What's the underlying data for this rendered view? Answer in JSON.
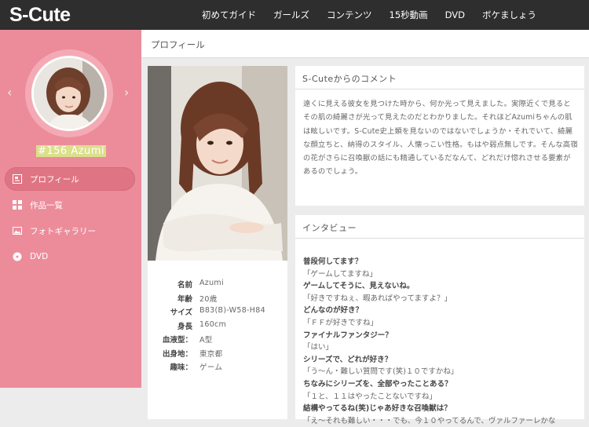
{
  "header": {
    "logo": "S-Cute",
    "nav": [
      "初めてガイド",
      "ガールズ",
      "コンテンツ",
      "15秒動画",
      "DVD",
      "ボケましょう"
    ]
  },
  "sidebar": {
    "member_name": "#156 Azumi",
    "prev_arrow": "‹",
    "next_arrow": "›",
    "menu": [
      {
        "label": "プロフィール",
        "icon": "profile-icon",
        "active": true
      },
      {
        "label": "作品一覧",
        "icon": "grid-icon",
        "active": false
      },
      {
        "label": "フォトギャラリー",
        "icon": "photo-icon",
        "active": false
      },
      {
        "label": "DVD",
        "icon": "disc-icon",
        "active": false
      }
    ]
  },
  "main": {
    "page_title": "プロフィール",
    "profile": [
      {
        "key": "名前",
        "value": "Azumi"
      },
      {
        "key": "年齢",
        "value": "20歳"
      },
      {
        "key": "サイズ",
        "value": "B83(B)-W58-H84"
      },
      {
        "key": "身長",
        "value": "160cm"
      },
      {
        "key": "血液型：",
        "value": "A型"
      },
      {
        "key": "出身地：",
        "value": "東京都"
      },
      {
        "key": "趣味：",
        "value": "ゲーム"
      }
    ],
    "comment": {
      "title": "S-Cuteからのコメント",
      "text": "遠くに見える彼女を見つけた時から、何か光って見えました。実際近くで見るとその肌の綺麗さが光って見えたのだとわかりました。それほどAzumiちゃんの肌は眩しいです。S-Cute史上類を見ないのではないでしょうか・それでいて、綺麗な顔立ちと、納得のスタイル、人懐っこい性格。もはや弱点無しです。そんな高嶺の花がさらに召喚獣の話にも精通しているだなんて、どれだけ惚れさせる要素があるのでしょう。"
    },
    "interview": {
      "title": "インタビュー",
      "lines": [
        {
          "type": "q",
          "text": "普段何してます？"
        },
        {
          "type": "a",
          "text": "「ゲームしてますね」"
        },
        {
          "type": "q",
          "text": "ゲームしてそうに、見えないね。"
        },
        {
          "type": "a",
          "text": "「好きですねぇ、暇あればやってますよ？」"
        },
        {
          "type": "q",
          "text": "どんなのが好き？"
        },
        {
          "type": "a",
          "text": "「ＦＦが好きですね」"
        },
        {
          "type": "q",
          "text": "ファイナルファンタジー？"
        },
        {
          "type": "a",
          "text": "「はい」"
        },
        {
          "type": "q",
          "text": "シリーズで、どれが好き？"
        },
        {
          "type": "a",
          "text": "「う～ん・難しい質問です(笑)１０ですかね」"
        },
        {
          "type": "q",
          "text": "ちなみにシリーズを、全部やったことある？"
        },
        {
          "type": "a",
          "text": "「１と、１１はやったことないですね」"
        },
        {
          "type": "q",
          "text": "結構やってるね(笑)じゃあ好きな召喚獣は？"
        },
        {
          "type": "a",
          "text": "「え～それも難しい・・・でも、今１０やってるんで、ヴァルファーレかな"
        }
      ]
    }
  },
  "colors": {
    "header_bg": "#2e2e2e",
    "sidebar_bg": "#ec8c9b",
    "name_highlight": "#dbe08a"
  }
}
